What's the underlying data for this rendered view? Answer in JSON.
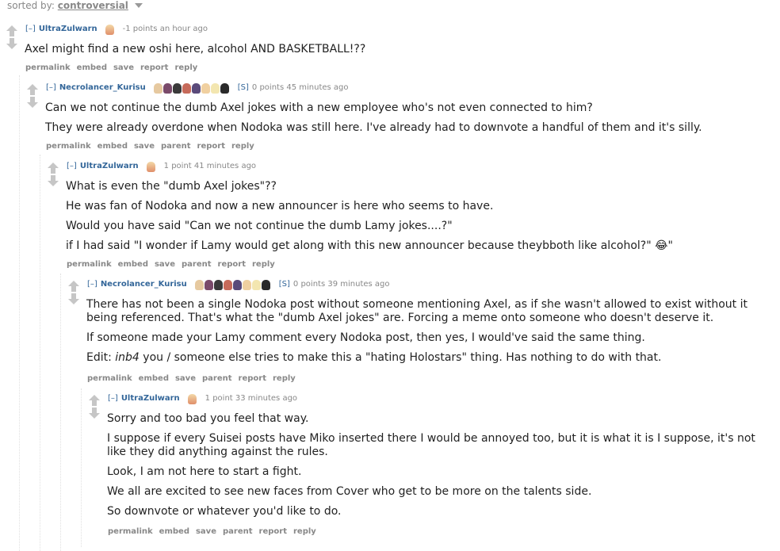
{
  "sort": {
    "label": "sorted by:",
    "value": "controversial"
  },
  "comments": [
    {
      "expand": "[–]",
      "author": "UltraZulwarn",
      "score": "-1 points an hour ago",
      "paragraphs": [
        "Axel might find a new oshi here, alcohol AND BASKETBALL!??"
      ],
      "buttons": [
        "permalink",
        "embed",
        "save",
        "report",
        "reply"
      ]
    },
    {
      "expand": "[–]",
      "author": "Necrolancer_Kurisu",
      "submitter": "[S]",
      "score": "0 points 45 minutes ago",
      "paragraphs": [
        "Can we not continue the dumb Axel jokes with a new employee who's not even connected to him?",
        "They were already overdone when Nodoka was still here. I've already had to downvote a handful of them and it's silly."
      ],
      "buttons": [
        "permalink",
        "embed",
        "save",
        "parent",
        "report",
        "reply"
      ]
    },
    {
      "expand": "[–]",
      "author": "UltraZulwarn",
      "score": "1 point 41 minutes ago",
      "paragraphs": [
        "What is even the \"dumb Axel jokes\"??",
        "He was fan of Nodoka and now a new announcer is here who seems to have.",
        "Would you have said \"Can we not continue the dumb Lamy jokes....?\"",
        "if I had said \"I wonder if Lamy would get along with this new announcer because theybboth like alcohol?\" 😂\""
      ],
      "buttons": [
        "permalink",
        "embed",
        "save",
        "parent",
        "report",
        "reply"
      ]
    },
    {
      "expand": "[–]",
      "author": "Necrolancer_Kurisu",
      "submitter": "[S]",
      "score": "0 points 39 minutes ago",
      "paragraphs": [
        "There has not been a single Nodoka post without someone mentioning Axel, as if she wasn't allowed to exist without it being referenced. That's what the \"dumb Axel jokes\" are. Forcing a meme onto someone who doesn't deserve it.",
        "If someone made your Lamy comment every Nodoka post, then yes, I would've said the same thing."
      ],
      "edit": {
        "prefix": "Edit: ",
        "em": "inb4",
        "rest": " you / someone else tries to make this a \"hating Holostars\" thing. Has nothing to do with that."
      },
      "buttons": [
        "permalink",
        "embed",
        "save",
        "parent",
        "report",
        "reply"
      ]
    },
    {
      "expand": "[–]",
      "author": "UltraZulwarn",
      "score": "1 point 33 minutes ago",
      "paragraphs": [
        "Sorry and too bad you feel that way.",
        "I suppose if every Suisei posts have Miko inserted there I would be annoyed too, but it is what it is I suppose, it's not like they did anything against the rules.",
        "Look, I am not here to start a fight.",
        "We all are excited to see new faces from Cover who get to be more on the talents side.",
        "So downvote or whatever you'd like to do."
      ],
      "buttons": [
        "permalink",
        "embed",
        "save",
        "parent",
        "report",
        "reply"
      ]
    }
  ],
  "colors": {
    "link": "#336699",
    "muted": "#888888",
    "arrow": "#c6c6c6"
  }
}
